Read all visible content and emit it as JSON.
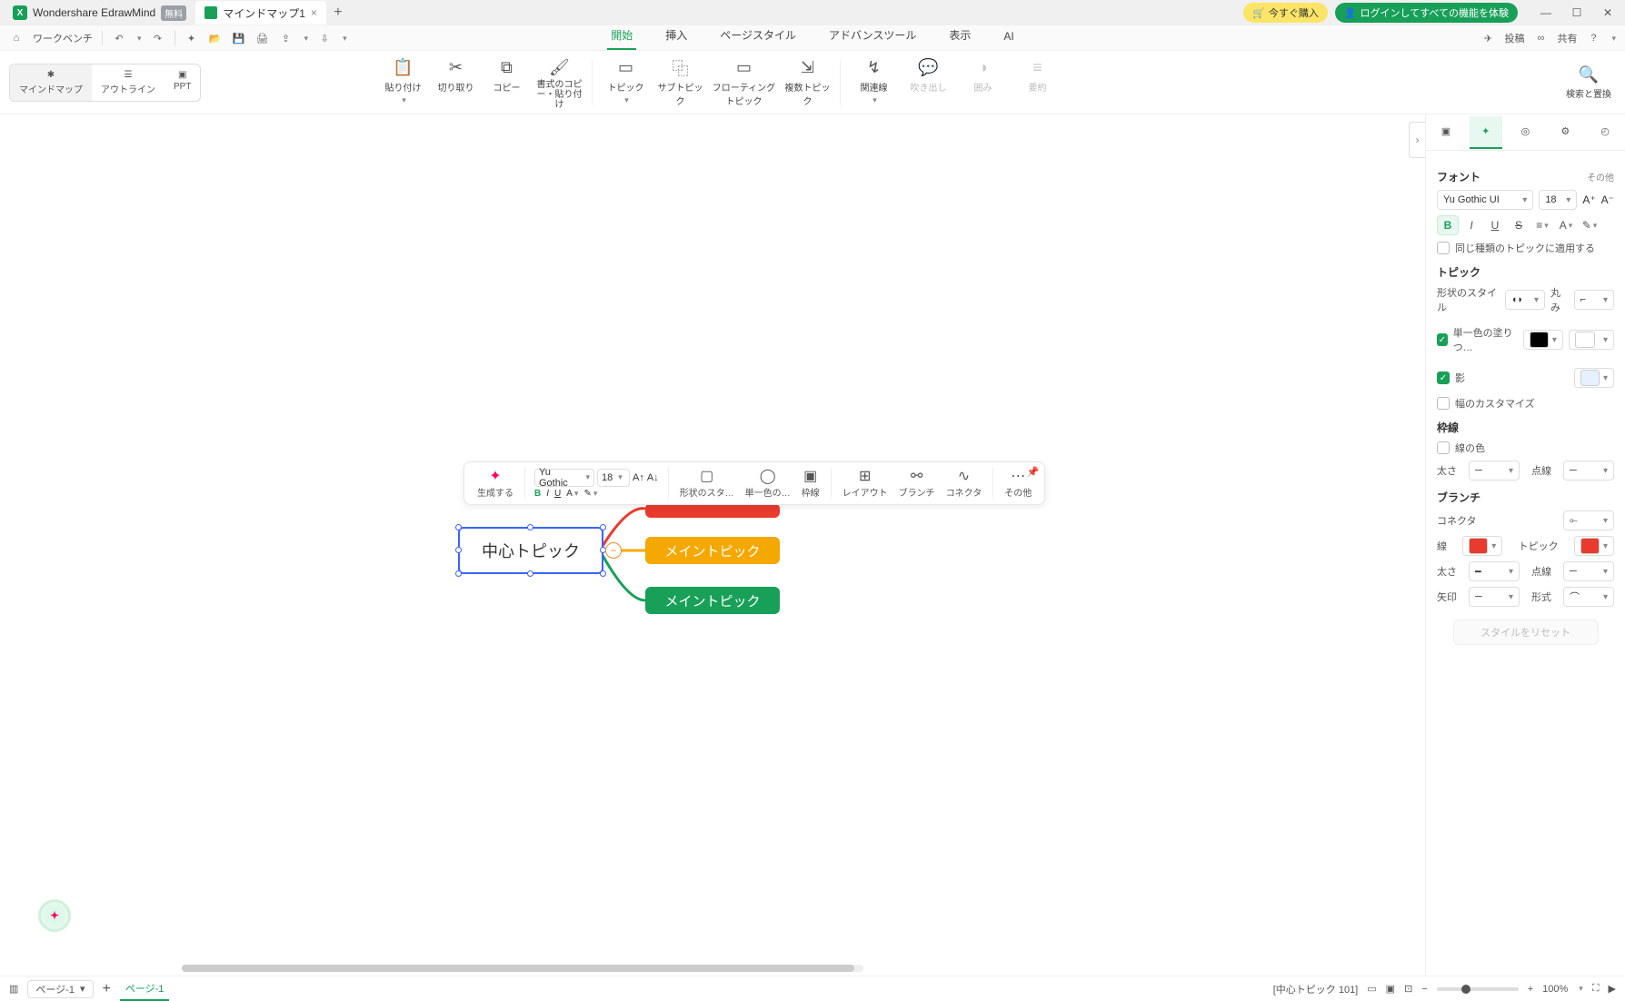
{
  "title": {
    "app": "Wondershare EdrawMind",
    "free": "無料",
    "doc": "マインドマップ1"
  },
  "titlebar": {
    "buy": "今すぐ購入",
    "login": "ログインしてすべての機能を体験"
  },
  "quickbar": {
    "workbench": "ワークベンチ",
    "post": "投稿",
    "share": "共有"
  },
  "menu": {
    "start": "開始",
    "insert": "挿入",
    "pagestyle": "ページスタイル",
    "advanced": "アドバンスツール",
    "view": "表示",
    "ai": "AI"
  },
  "viewswitch": {
    "mindmap": "マインドマップ",
    "outline": "アウトライン",
    "ppt": "PPT"
  },
  "ribbon": {
    "paste": "貼り付け",
    "cut": "切り取り",
    "copy": "コピー",
    "formatc": "書式のコピー・貼り付け",
    "topic": "トピック",
    "subtopic": "サブトピック",
    "floating": "フローティングトピック",
    "multi": "複数トピック",
    "relation": "関連線",
    "callout": "吹き出し",
    "boundary": "囲み",
    "summary": "要約",
    "search": "検索と置換"
  },
  "canvas": {
    "center": "中心トピック",
    "main1": "メイントピック",
    "main2": "メイントピック"
  },
  "float": {
    "generate": "生成する",
    "font": "Yu Gothic",
    "size": "18",
    "shape": "形状のスタ…",
    "fill": "単一色の…",
    "border": "枠線",
    "layout": "レイアウト",
    "branch": "ブランチ",
    "connector": "コネクタ",
    "more": "その他"
  },
  "side": {
    "font": "フォント",
    "other": "その他",
    "fontname": "Yu Gothic UI",
    "fontsize": "18",
    "apply_same": "同じ種類のトピックに適用する",
    "topic": "トピック",
    "shape_style": "形状のスタイル",
    "round": "丸み",
    "fill_one": "単一色の塗りつ…",
    "shadow": "影",
    "width_custom": "幅のカスタマイズ",
    "border": "枠線",
    "border_color": "線の色",
    "thickness": "太さ",
    "dash": "点線",
    "branch": "ブランチ",
    "connector": "コネクタ",
    "line": "線",
    "topic2": "トピック",
    "arrow": "矢印",
    "format": "形式",
    "reset": "スタイルをリセット"
  },
  "status": {
    "page": "ページ-1",
    "pagetab": "ページ-1",
    "selection": "[中心トピック 101]",
    "zoom": "100%"
  },
  "colors": {
    "branch_line": "#e83b2e",
    "branch_topic": "#e83b2e"
  }
}
